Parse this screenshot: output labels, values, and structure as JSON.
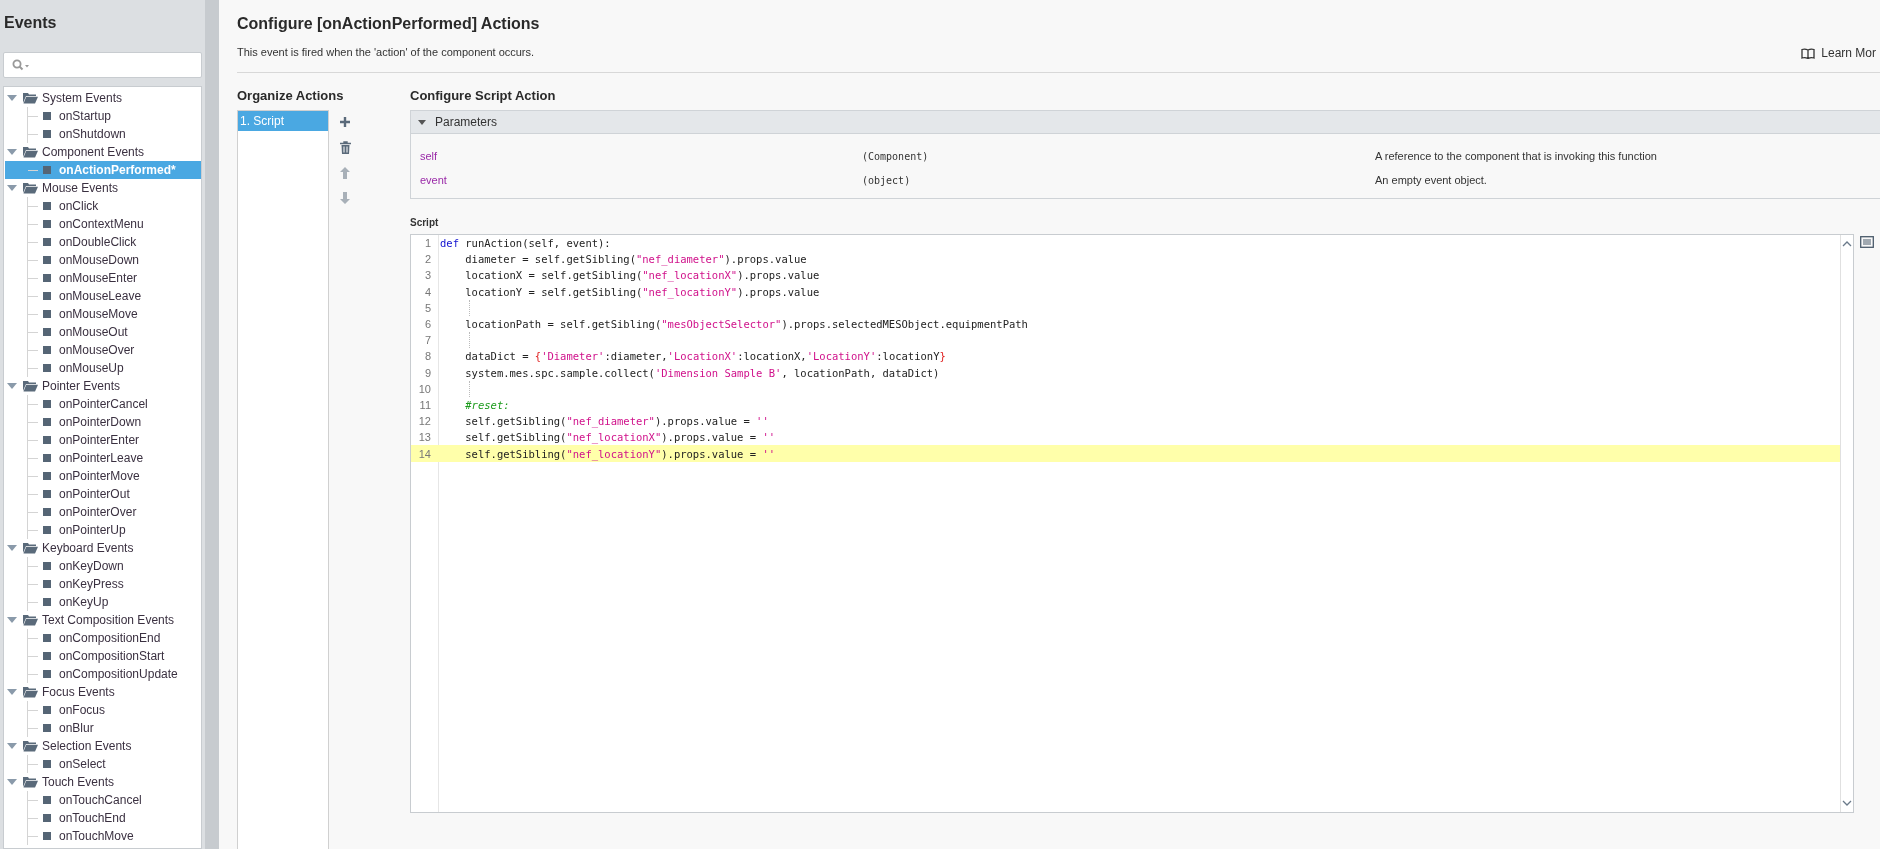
{
  "sidebar": {
    "title": "Events",
    "tree": [
      {
        "label": "System Events",
        "expanded": true,
        "selected": false,
        "children": [
          {
            "label": "onStartup",
            "selected": false
          },
          {
            "label": "onShutdown",
            "selected": false
          }
        ]
      },
      {
        "label": "Component Events",
        "expanded": true,
        "selected": false,
        "children": [
          {
            "label": "onActionPerformed*",
            "selected": true
          }
        ]
      },
      {
        "label": "Mouse Events",
        "expanded": true,
        "selected": false,
        "children": [
          {
            "label": "onClick",
            "selected": false
          },
          {
            "label": "onContextMenu",
            "selected": false
          },
          {
            "label": "onDoubleClick",
            "selected": false
          },
          {
            "label": "onMouseDown",
            "selected": false
          },
          {
            "label": "onMouseEnter",
            "selected": false
          },
          {
            "label": "onMouseLeave",
            "selected": false
          },
          {
            "label": "onMouseMove",
            "selected": false
          },
          {
            "label": "onMouseOut",
            "selected": false
          },
          {
            "label": "onMouseOver",
            "selected": false
          },
          {
            "label": "onMouseUp",
            "selected": false
          }
        ]
      },
      {
        "label": "Pointer Events",
        "expanded": true,
        "selected": false,
        "children": [
          {
            "label": "onPointerCancel",
            "selected": false
          },
          {
            "label": "onPointerDown",
            "selected": false
          },
          {
            "label": "onPointerEnter",
            "selected": false
          },
          {
            "label": "onPointerLeave",
            "selected": false
          },
          {
            "label": "onPointerMove",
            "selected": false
          },
          {
            "label": "onPointerOut",
            "selected": false
          },
          {
            "label": "onPointerOver",
            "selected": false
          },
          {
            "label": "onPointerUp",
            "selected": false
          }
        ]
      },
      {
        "label": "Keyboard Events",
        "expanded": true,
        "selected": false,
        "children": [
          {
            "label": "onKeyDown",
            "selected": false
          },
          {
            "label": "onKeyPress",
            "selected": false
          },
          {
            "label": "onKeyUp",
            "selected": false
          }
        ]
      },
      {
        "label": "Text Composition Events",
        "expanded": true,
        "selected": false,
        "children": [
          {
            "label": "onCompositionEnd",
            "selected": false
          },
          {
            "label": "onCompositionStart",
            "selected": false
          },
          {
            "label": "onCompositionUpdate",
            "selected": false
          }
        ]
      },
      {
        "label": "Focus Events",
        "expanded": true,
        "selected": false,
        "children": [
          {
            "label": "onFocus",
            "selected": false
          },
          {
            "label": "onBlur",
            "selected": false
          }
        ]
      },
      {
        "label": "Selection Events",
        "expanded": true,
        "selected": false,
        "children": [
          {
            "label": "onSelect",
            "selected": false
          }
        ]
      },
      {
        "label": "Touch Events",
        "expanded": true,
        "selected": false,
        "children": [
          {
            "label": "onTouchCancel",
            "selected": false
          },
          {
            "label": "onTouchEnd",
            "selected": false
          },
          {
            "label": "onTouchMove",
            "selected": false
          }
        ]
      }
    ]
  },
  "header": {
    "title": "Configure [onActionPerformed] Actions",
    "description": "This event is fired when the 'action' of the component occurs.",
    "learn_more": "Learn Mor"
  },
  "organize": {
    "title": "Organize Actions",
    "actions": [
      {
        "label": "1. Script",
        "selected": true
      }
    ]
  },
  "configure": {
    "title": "Configure Script Action",
    "parameters": {
      "title": "Parameters",
      "expanded": true,
      "rows": [
        {
          "name": "self",
          "type": "(Component)",
          "description": "A reference to the component that is invoking this function"
        },
        {
          "name": "event",
          "type": "(object)",
          "description": "An empty event object."
        }
      ]
    },
    "script_label": "Script",
    "code": [
      {
        "number": "1",
        "selected": false,
        "segments": [
          {
            "kind": "keyword",
            "text": "def"
          },
          {
            "kind": "plain",
            "text": " runAction(self, event):"
          }
        ]
      },
      {
        "number": "2",
        "selected": false,
        "segments": [
          {
            "kind": "plain",
            "text": "    diameter = self.getSibling("
          },
          {
            "kind": "string",
            "text": "\"nef_diameter\""
          },
          {
            "kind": "plain",
            "text": ").props.value"
          }
        ]
      },
      {
        "number": "3",
        "selected": false,
        "segments": [
          {
            "kind": "plain",
            "text": "    locationX = self.getSibling("
          },
          {
            "kind": "string",
            "text": "\"nef_locationX\""
          },
          {
            "kind": "plain",
            "text": ").props.value"
          }
        ]
      },
      {
        "number": "4",
        "selected": false,
        "segments": [
          {
            "kind": "plain",
            "text": "    locationY = self.getSibling("
          },
          {
            "kind": "string",
            "text": "\"nef_locationY\""
          },
          {
            "kind": "plain",
            "text": ").props.value"
          }
        ]
      },
      {
        "number": "5",
        "selected": false
      },
      {
        "number": "6",
        "selected": false,
        "segments": [
          {
            "kind": "plain",
            "text": "    locationPath = self.getSibling("
          },
          {
            "kind": "string",
            "text": "\"mesObjectSelector\""
          },
          {
            "kind": "plain",
            "text": ").props.selectedMESObject.equipmentPath"
          }
        ]
      },
      {
        "number": "7",
        "selected": false
      },
      {
        "number": "8",
        "selected": false,
        "segments": [
          {
            "kind": "plain",
            "text": "    dataDict = "
          },
          {
            "kind": "brace",
            "text": "{"
          },
          {
            "kind": "string",
            "text": "'Diameter'"
          },
          {
            "kind": "plain",
            "text": ":diameter,"
          },
          {
            "kind": "string",
            "text": "'LocationX'"
          },
          {
            "kind": "plain",
            "text": ":locationX,"
          },
          {
            "kind": "string",
            "text": "'LocationY'"
          },
          {
            "kind": "plain",
            "text": ":locationY"
          },
          {
            "kind": "brace",
            "text": "}"
          }
        ]
      },
      {
        "number": "9",
        "selected": false,
        "segments": [
          {
            "kind": "plain",
            "text": "    system.mes.spc.sample.collect("
          },
          {
            "kind": "string",
            "text": "'Dimension Sample B'"
          },
          {
            "kind": "plain",
            "text": ", locationPath, dataDict)"
          }
        ]
      },
      {
        "number": "10",
        "selected": false
      },
      {
        "number": "11",
        "selected": false,
        "segments": [
          {
            "kind": "comment",
            "text": "    #reset:"
          }
        ]
      },
      {
        "number": "12",
        "selected": false,
        "segments": [
          {
            "kind": "plain",
            "text": "    self.getSibling("
          },
          {
            "kind": "string",
            "text": "\"nef_diameter\""
          },
          {
            "kind": "plain",
            "text": ").props.value = "
          },
          {
            "kind": "string",
            "text": "''"
          }
        ]
      },
      {
        "number": "13",
        "selected": false,
        "segments": [
          {
            "kind": "plain",
            "text": "    self.getSibling("
          },
          {
            "kind": "string",
            "text": "\"nef_locationX\""
          },
          {
            "kind": "plain",
            "text": ").props.value = "
          },
          {
            "kind": "string",
            "text": "''"
          }
        ]
      },
      {
        "number": "14",
        "selected": true,
        "segments": [
          {
            "kind": "plain",
            "text": "    self.getSibling("
          },
          {
            "kind": "string",
            "text": "\"nef_locationY\""
          },
          {
            "kind": "plain",
            "text": ").props.value = "
          },
          {
            "kind": "string",
            "text": "''"
          }
        ]
      }
    ]
  }
}
